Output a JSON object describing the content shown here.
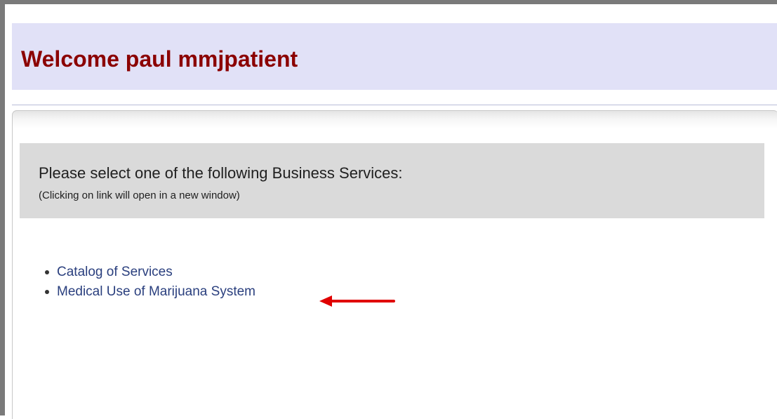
{
  "header": {
    "welcome_text": "Welcome paul mmjpatient"
  },
  "services": {
    "title": "Please select one of the following Business Services:",
    "note": "(Clicking on link will open in a new window)",
    "links": [
      {
        "label": "Catalog of Services"
      },
      {
        "label": "Medical Use of Marijuana System"
      }
    ]
  },
  "colors": {
    "welcome": "#8b0000",
    "header_band": "#e1e1f7",
    "services_box": "#dadada",
    "link": "#2a3f7e",
    "annotation_arrow": "#e00000"
  },
  "icons": [
    "left-arrow-annotation-icon"
  ]
}
